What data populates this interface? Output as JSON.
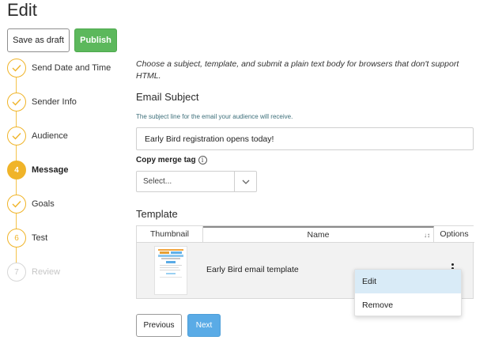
{
  "page": {
    "title": "Edit"
  },
  "actions": {
    "save_draft": "Save as draft",
    "publish": "Publish"
  },
  "steps": [
    {
      "num": "",
      "label": "Send Date and Time",
      "state": "done"
    },
    {
      "num": "",
      "label": "Sender Info",
      "state": "done"
    },
    {
      "num": "",
      "label": "Audience",
      "state": "done"
    },
    {
      "num": "4",
      "label": "Message",
      "state": "active"
    },
    {
      "num": "",
      "label": "Goals",
      "state": "done"
    },
    {
      "num": "6",
      "label": "Test",
      "state": "pending"
    },
    {
      "num": "7",
      "label": "Review",
      "state": "disabled"
    }
  ],
  "main": {
    "intro": "Choose a subject, template, and submit a plain text body for browsers that don't support HTML.",
    "subject": {
      "title": "Email Subject",
      "help": "The subject line for the email your audience will receive.",
      "value": "Early Bird registration opens today!"
    },
    "merge": {
      "label": "Copy merge tag",
      "selected": "Select..."
    },
    "template": {
      "title": "Template",
      "columns": {
        "thumbnail": "Thumbnail",
        "name": "Name",
        "options": "Options"
      },
      "rows": [
        {
          "name": "Early Bird email template"
        }
      ]
    },
    "menu": {
      "edit": "Edit",
      "remove": "Remove"
    }
  },
  "nav": {
    "previous": "Previous",
    "next": "Next"
  },
  "colors": {
    "publish": "#5cb85c",
    "step_accent": "#f0b429",
    "next": "#5aabe6",
    "menu_hover": "#d9ebf7"
  },
  "icons": {
    "done": "check-icon",
    "info": "info-icon",
    "select": "chevron-down-icon",
    "sort": "sort-icon",
    "options": "kebab-icon"
  }
}
